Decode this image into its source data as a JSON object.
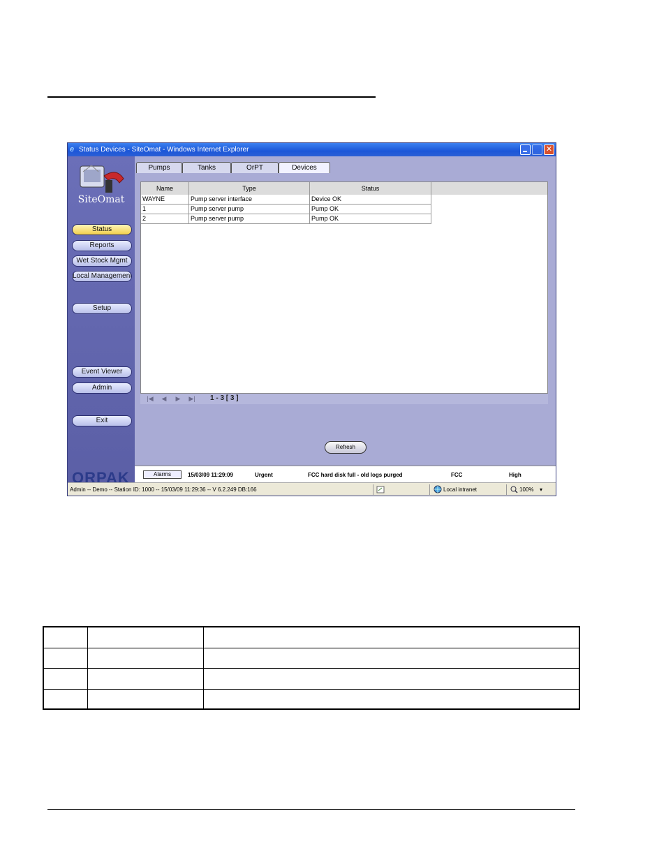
{
  "window": {
    "title": "Status Devices - SiteOmat - Windows Internet Explorer",
    "close_glyph": "✕"
  },
  "sidebar": {
    "app_name": "SiteOmat",
    "items": [
      {
        "label": "Status"
      },
      {
        "label": "Reports"
      },
      {
        "label": "Wet Stock Mgmt"
      },
      {
        "label": "Local Management"
      },
      {
        "label": "Setup"
      },
      {
        "label": "Event Viewer"
      },
      {
        "label": "Admin"
      },
      {
        "label": "Exit"
      }
    ],
    "company_logo": "ORPAK"
  },
  "tabs": [
    {
      "label": "Pumps"
    },
    {
      "label": "Tanks"
    },
    {
      "label": "OrPT"
    },
    {
      "label": "Devices"
    }
  ],
  "active_tab": "Devices",
  "grid": {
    "headers": [
      "Name",
      "Type",
      "Status"
    ],
    "rows": [
      [
        "WAYNE",
        "Pump server interface",
        "Device OK"
      ],
      [
        "1",
        "Pump server pump",
        "Pump OK"
      ],
      [
        "2",
        "Pump server pump",
        "Pump OK"
      ]
    ]
  },
  "pager": {
    "first": "|◀",
    "prev": "◀",
    "next": "▶",
    "last": "▶|",
    "count": "1 - 3  [ 3 ]"
  },
  "refresh_label": "Refresh",
  "alarm": {
    "button": "Alarms",
    "time": "15/03/09 11:29:09",
    "severity": "Urgent",
    "message": "FCC hard disk full - old logs purged",
    "source": "FCC",
    "priority": "High"
  },
  "statusbar": {
    "info": "Admin -- Demo -- Station ID: 1000 -- 15/03/09  11:29:36 -- V 6.2.249 DB:166",
    "zone": "Local intranet",
    "zoom": "100%",
    "zoom_arrow": "▾"
  }
}
